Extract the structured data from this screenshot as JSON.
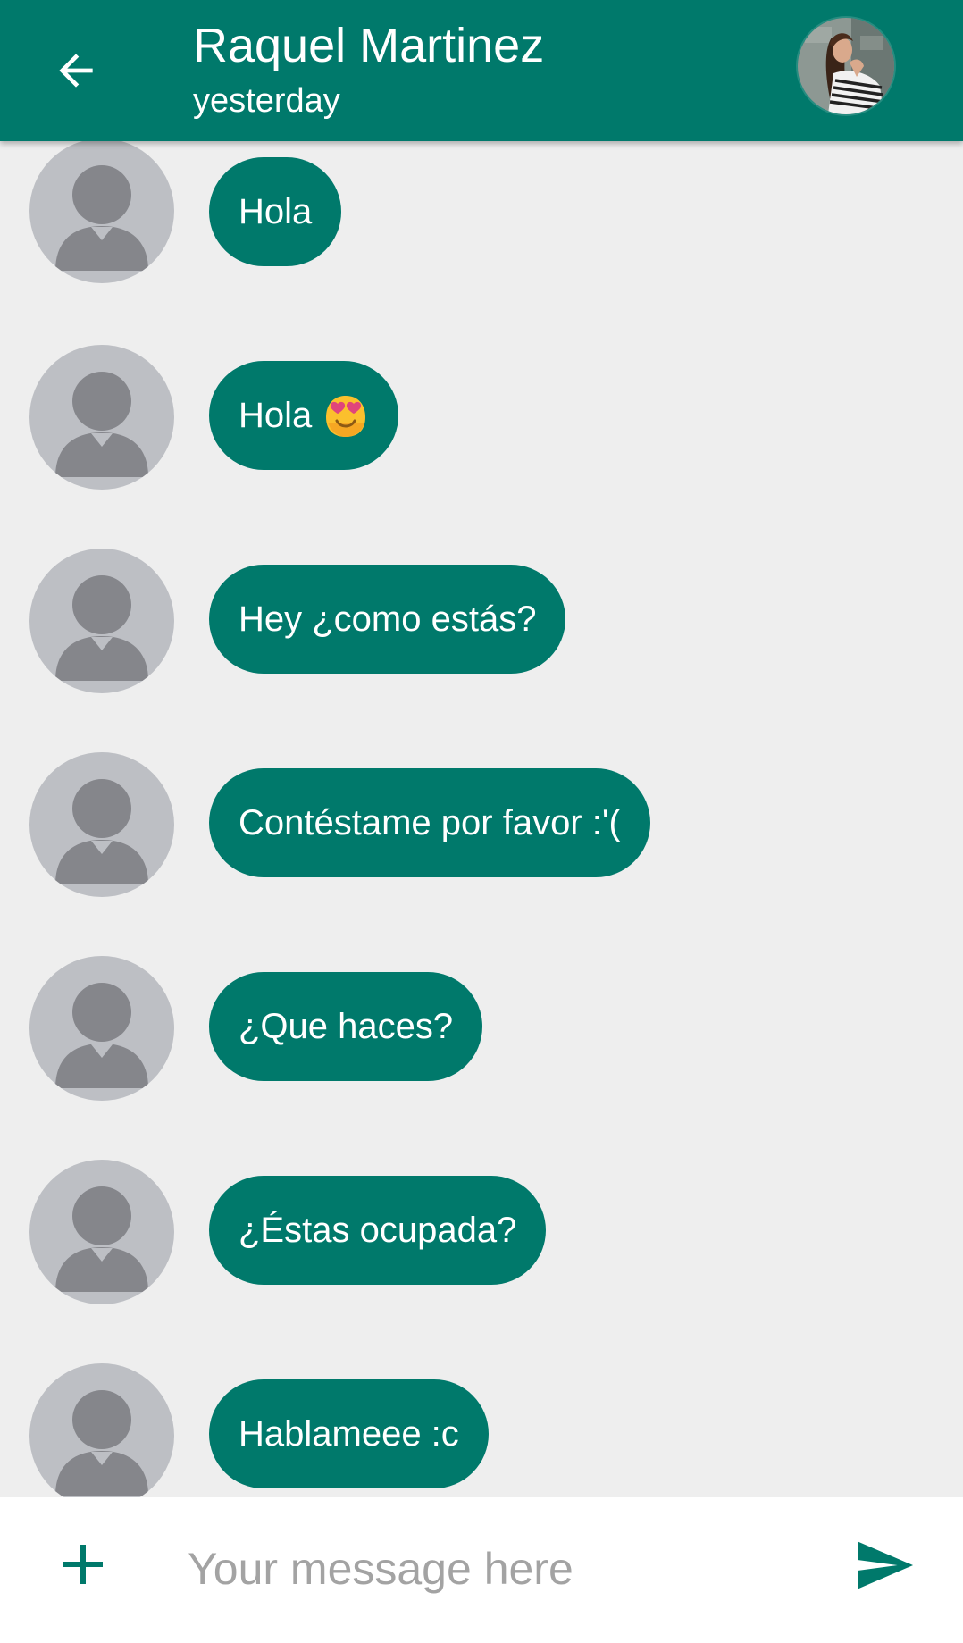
{
  "header": {
    "title": "Raquel Martinez",
    "subtitle": "yesterday",
    "back_icon": "arrow-back-icon",
    "avatar": "contact-photo"
  },
  "messages": [
    {
      "text": "Hola",
      "emoji": ""
    },
    {
      "text": "Hola",
      "emoji": "smiling-face-with-heart-eyes-emoji"
    },
    {
      "text": "Hey ¿como estás?",
      "emoji": ""
    },
    {
      "text": "Contéstame por favor :'(",
      "emoji": ""
    },
    {
      "text": "¿Que haces?",
      "emoji": ""
    },
    {
      "text": "¿Éstas ocupada?",
      "emoji": ""
    },
    {
      "text": "Hablameee :c",
      "emoji": ""
    }
  ],
  "composer": {
    "placeholder": "Your message here",
    "value": "",
    "add_icon": "plus-icon",
    "send_icon": "send-icon"
  },
  "colors": {
    "primary": "#00796b",
    "background": "#eeeeee",
    "avatar_bg": "#bdbfc4",
    "avatar_fg": "#85868b",
    "placeholder": "#a3a3a3"
  }
}
